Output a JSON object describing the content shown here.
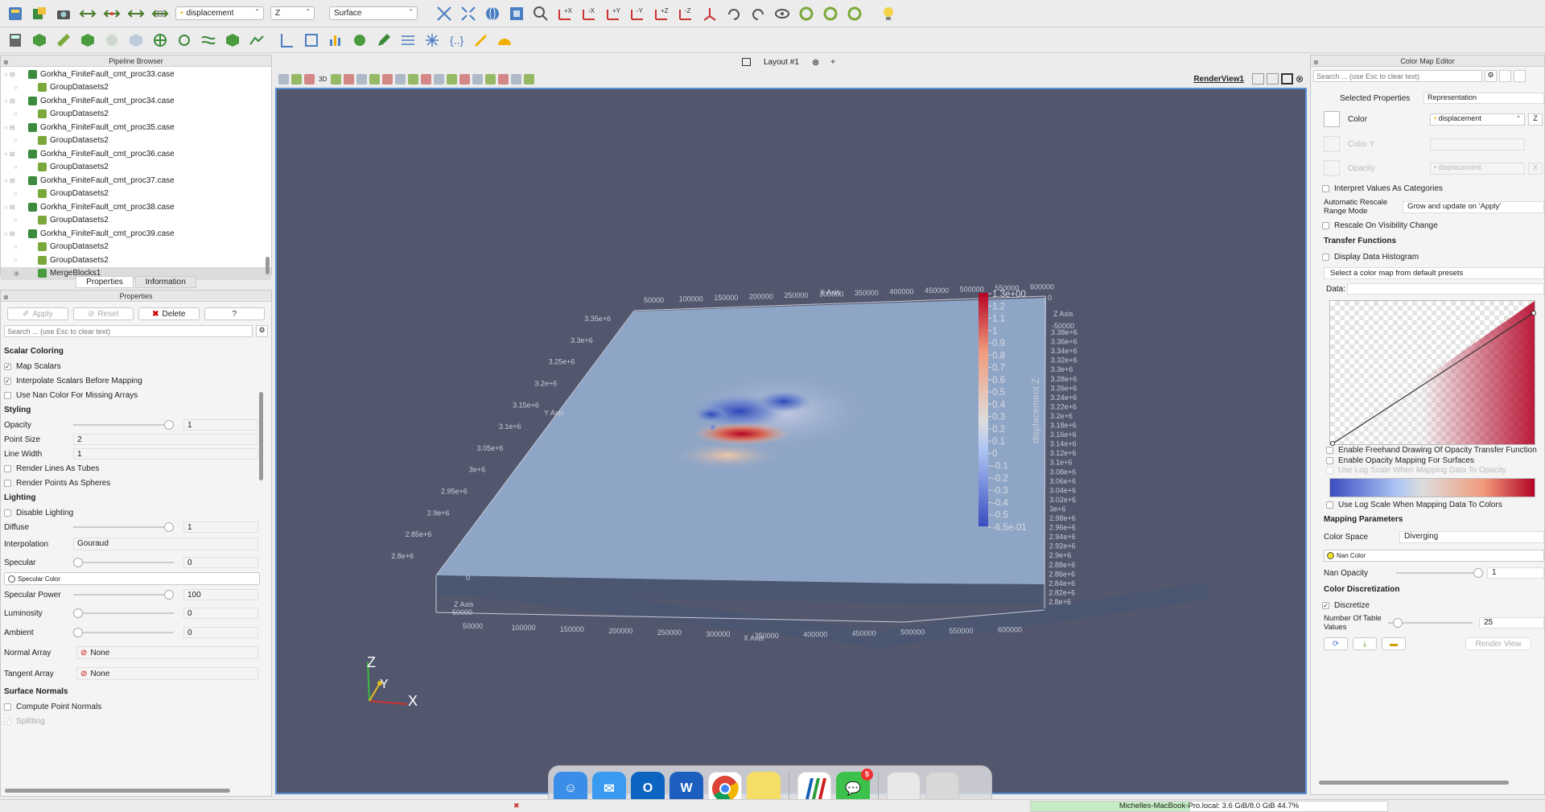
{
  "toolbar": {
    "array_select": "displacement",
    "component_select": "Z",
    "representation_select": "Surface"
  },
  "pipeline_browser": {
    "title": "Pipeline Browser",
    "items": [
      {
        "label": "Gorkha_FiniteFault_cmt_proc33.case",
        "kind": "case"
      },
      {
        "label": "GroupDatasets2",
        "kind": "group"
      },
      {
        "label": "Gorkha_FiniteFault_cmt_proc34.case",
        "kind": "case"
      },
      {
        "label": "GroupDatasets2",
        "kind": "group"
      },
      {
        "label": "Gorkha_FiniteFault_cmt_proc35.case",
        "kind": "case"
      },
      {
        "label": "GroupDatasets2",
        "kind": "group"
      },
      {
        "label": "Gorkha_FiniteFault_cmt_proc36.case",
        "kind": "case"
      },
      {
        "label": "GroupDatasets2",
        "kind": "group"
      },
      {
        "label": "Gorkha_FiniteFault_cmt_proc37.case",
        "kind": "case"
      },
      {
        "label": "GroupDatasets2",
        "kind": "group"
      },
      {
        "label": "Gorkha_FiniteFault_cmt_proc38.case",
        "kind": "case"
      },
      {
        "label": "GroupDatasets2",
        "kind": "group"
      },
      {
        "label": "Gorkha_FiniteFault_cmt_proc39.case",
        "kind": "case"
      },
      {
        "label": "GroupDatasets2",
        "kind": "group"
      },
      {
        "label": "GroupDatasets2",
        "kind": "group"
      },
      {
        "label": "MergeBlocks1",
        "kind": "merge"
      }
    ]
  },
  "tabs": {
    "properties": "Properties",
    "information": "Information"
  },
  "properties": {
    "title": "Properties",
    "apply": "Apply",
    "reset": "Reset",
    "delete": "Delete",
    "help": "?",
    "search_placeholder": "Search ... (use Esc to clear text)",
    "scalar_coloring": "Scalar Coloring",
    "map_scalars": "Map Scalars",
    "interpolate": "Interpolate Scalars Before Mapping",
    "nan_color": "Use Nan Color For Missing Arrays",
    "styling": "Styling",
    "opacity_label": "Opacity",
    "opacity_value": "1",
    "point_size_label": "Point Size",
    "point_size_value": "2",
    "line_width_label": "Line Width",
    "line_width_value": "1",
    "lines_tubes": "Render Lines As Tubes",
    "points_spheres": "Render Points As Spheres",
    "lighting": "Lighting",
    "disable_lighting": "Disable Lighting",
    "diffuse_label": "Diffuse",
    "diffuse_value": "1",
    "interpolation_label": "Interpolation",
    "interpolation_value": "Gouraud",
    "specular_label": "Specular",
    "specular_value": "0",
    "specular_color": "Specular Color",
    "specular_power_label": "Specular Power",
    "specular_power_value": "100",
    "luminosity_label": "Luminosity",
    "luminosity_value": "0",
    "ambient_label": "Ambient",
    "ambient_value": "0",
    "normal_array_label": "Normal Array",
    "normal_array_value": "None",
    "tangent_array_label": "Tangent Array",
    "tangent_array_value": "None",
    "surface_normals": "Surface Normals",
    "compute_normals": "Compute Point Normals",
    "splitting": "Splitting"
  },
  "layout": {
    "tab": "Layout #1",
    "add": "+",
    "view_name": "RenderView1",
    "view_3d": "3D"
  },
  "scene": {
    "x_axis": "X Axis",
    "y_axis": "Y Axis",
    "z_axis": "Z Axis",
    "x_ticks": [
      "50000",
      "100000",
      "150000",
      "200000",
      "250000",
      "300000",
      "350000",
      "400000",
      "450000",
      "500000",
      "550000",
      "600000"
    ],
    "y_ticks_left": [
      "3.35e+6",
      "3.3e+6",
      "3.25e+6",
      "3.2e+6",
      "3.15e+6",
      "3.1e+6",
      "3.05e+6",
      "3e+6",
      "2.95e+6",
      "2.9e+6",
      "2.85e+6",
      "2.8e+6"
    ],
    "y_ticks_right": [
      "3.38e+6",
      "3.36e+6",
      "3.34e+6",
      "3.32e+6",
      "3.3e+6",
      "3.28e+6",
      "3.26e+6",
      "3.24e+6",
      "3.22e+6",
      "3.2e+6",
      "3.18e+6",
      "3.16e+6",
      "3.14e+6",
      "3.12e+6",
      "3.1e+6",
      "3.08e+6",
      "3.06e+6",
      "3.04e+6",
      "3.02e+6",
      "3e+6",
      "2.98e+6",
      "2.96e+6",
      "2.94e+6",
      "2.92e+6",
      "2.9e+6",
      "2.88e+6",
      "2.86e+6",
      "2.84e+6",
      "2.82e+6",
      "2.8e+6"
    ],
    "z_top": "0",
    "z_bottom": "-50000",
    "triad": {
      "x": "X",
      "y": "Y",
      "z": "Z"
    }
  },
  "colorbar": {
    "title": "displacement Z",
    "labels": [
      "1.3e+00",
      "1.2",
      "1.1",
      "1",
      "0.9",
      "0.8",
      "0.7",
      "0.6",
      "0.5",
      "0.4",
      "0.3",
      "0.2",
      "0.1",
      "0",
      "-0.1",
      "-0.2",
      "-0.3",
      "-0.4",
      "-0.5",
      "-6.5e-01"
    ],
    "min": -0.65,
    "max": 1.3
  },
  "color_map_editor": {
    "title": "Color Map Editor",
    "search_placeholder": "Search ... (use Esc to clear text)",
    "selected_properties_label": "Selected Properties",
    "selected_properties_value": "Representation",
    "color_label": "Color",
    "color_value": "displacement",
    "color_component": "Z",
    "color_y_label": "Color Y",
    "opacity_label": "Opacity",
    "opacity_value": "displacement",
    "opacity_component": "X",
    "interpret_categories": "Interpret Values As Categories",
    "auto_rescale_label": "Automatic Rescale Range Mode",
    "auto_rescale_value": "Grow and update on 'Apply'",
    "rescale_visibility": "Rescale On Visibility Change",
    "transfer_functions": "Transfer Functions",
    "display_histogram": "Display Data Histogram",
    "preset_placeholder": "Select a color map from default presets",
    "data_label": "Data:",
    "freehand": "Enable Freehand Drawing Of Opacity Transfer Function",
    "opacity_mapping": "Enable Opacity Mapping For Surfaces",
    "log_opacity": "Use Log Scale When Mapping Data To Opacity",
    "log_colors": "Use Log Scale When Mapping Data To Colors",
    "mapping_params": "Mapping Parameters",
    "color_space_label": "Color Space",
    "color_space_value": "Diverging",
    "nan_color": "Nan Color",
    "nan_opacity_label": "Nan Opacity",
    "nan_opacity_value": "1",
    "discretization": "Color Discretization",
    "discretize": "Discretize",
    "table_values_label": "Number Of Table Values",
    "table_values_value": "25",
    "render_view": "Render View"
  },
  "dock": {
    "messages_badge": "5"
  },
  "status": {
    "memory": "Michelles-MacBook-Pro.local: 3.6 GiB/8.0 GiB 44.7%",
    "memory_fraction": 0.447
  },
  "colors": {
    "view_bg": "#52576e",
    "slab_top": "#8fa5c6",
    "slab_front": "#4b5670",
    "cool": "#3b4cc0",
    "warm": "#b40426",
    "accent": "#5a8fd0"
  }
}
